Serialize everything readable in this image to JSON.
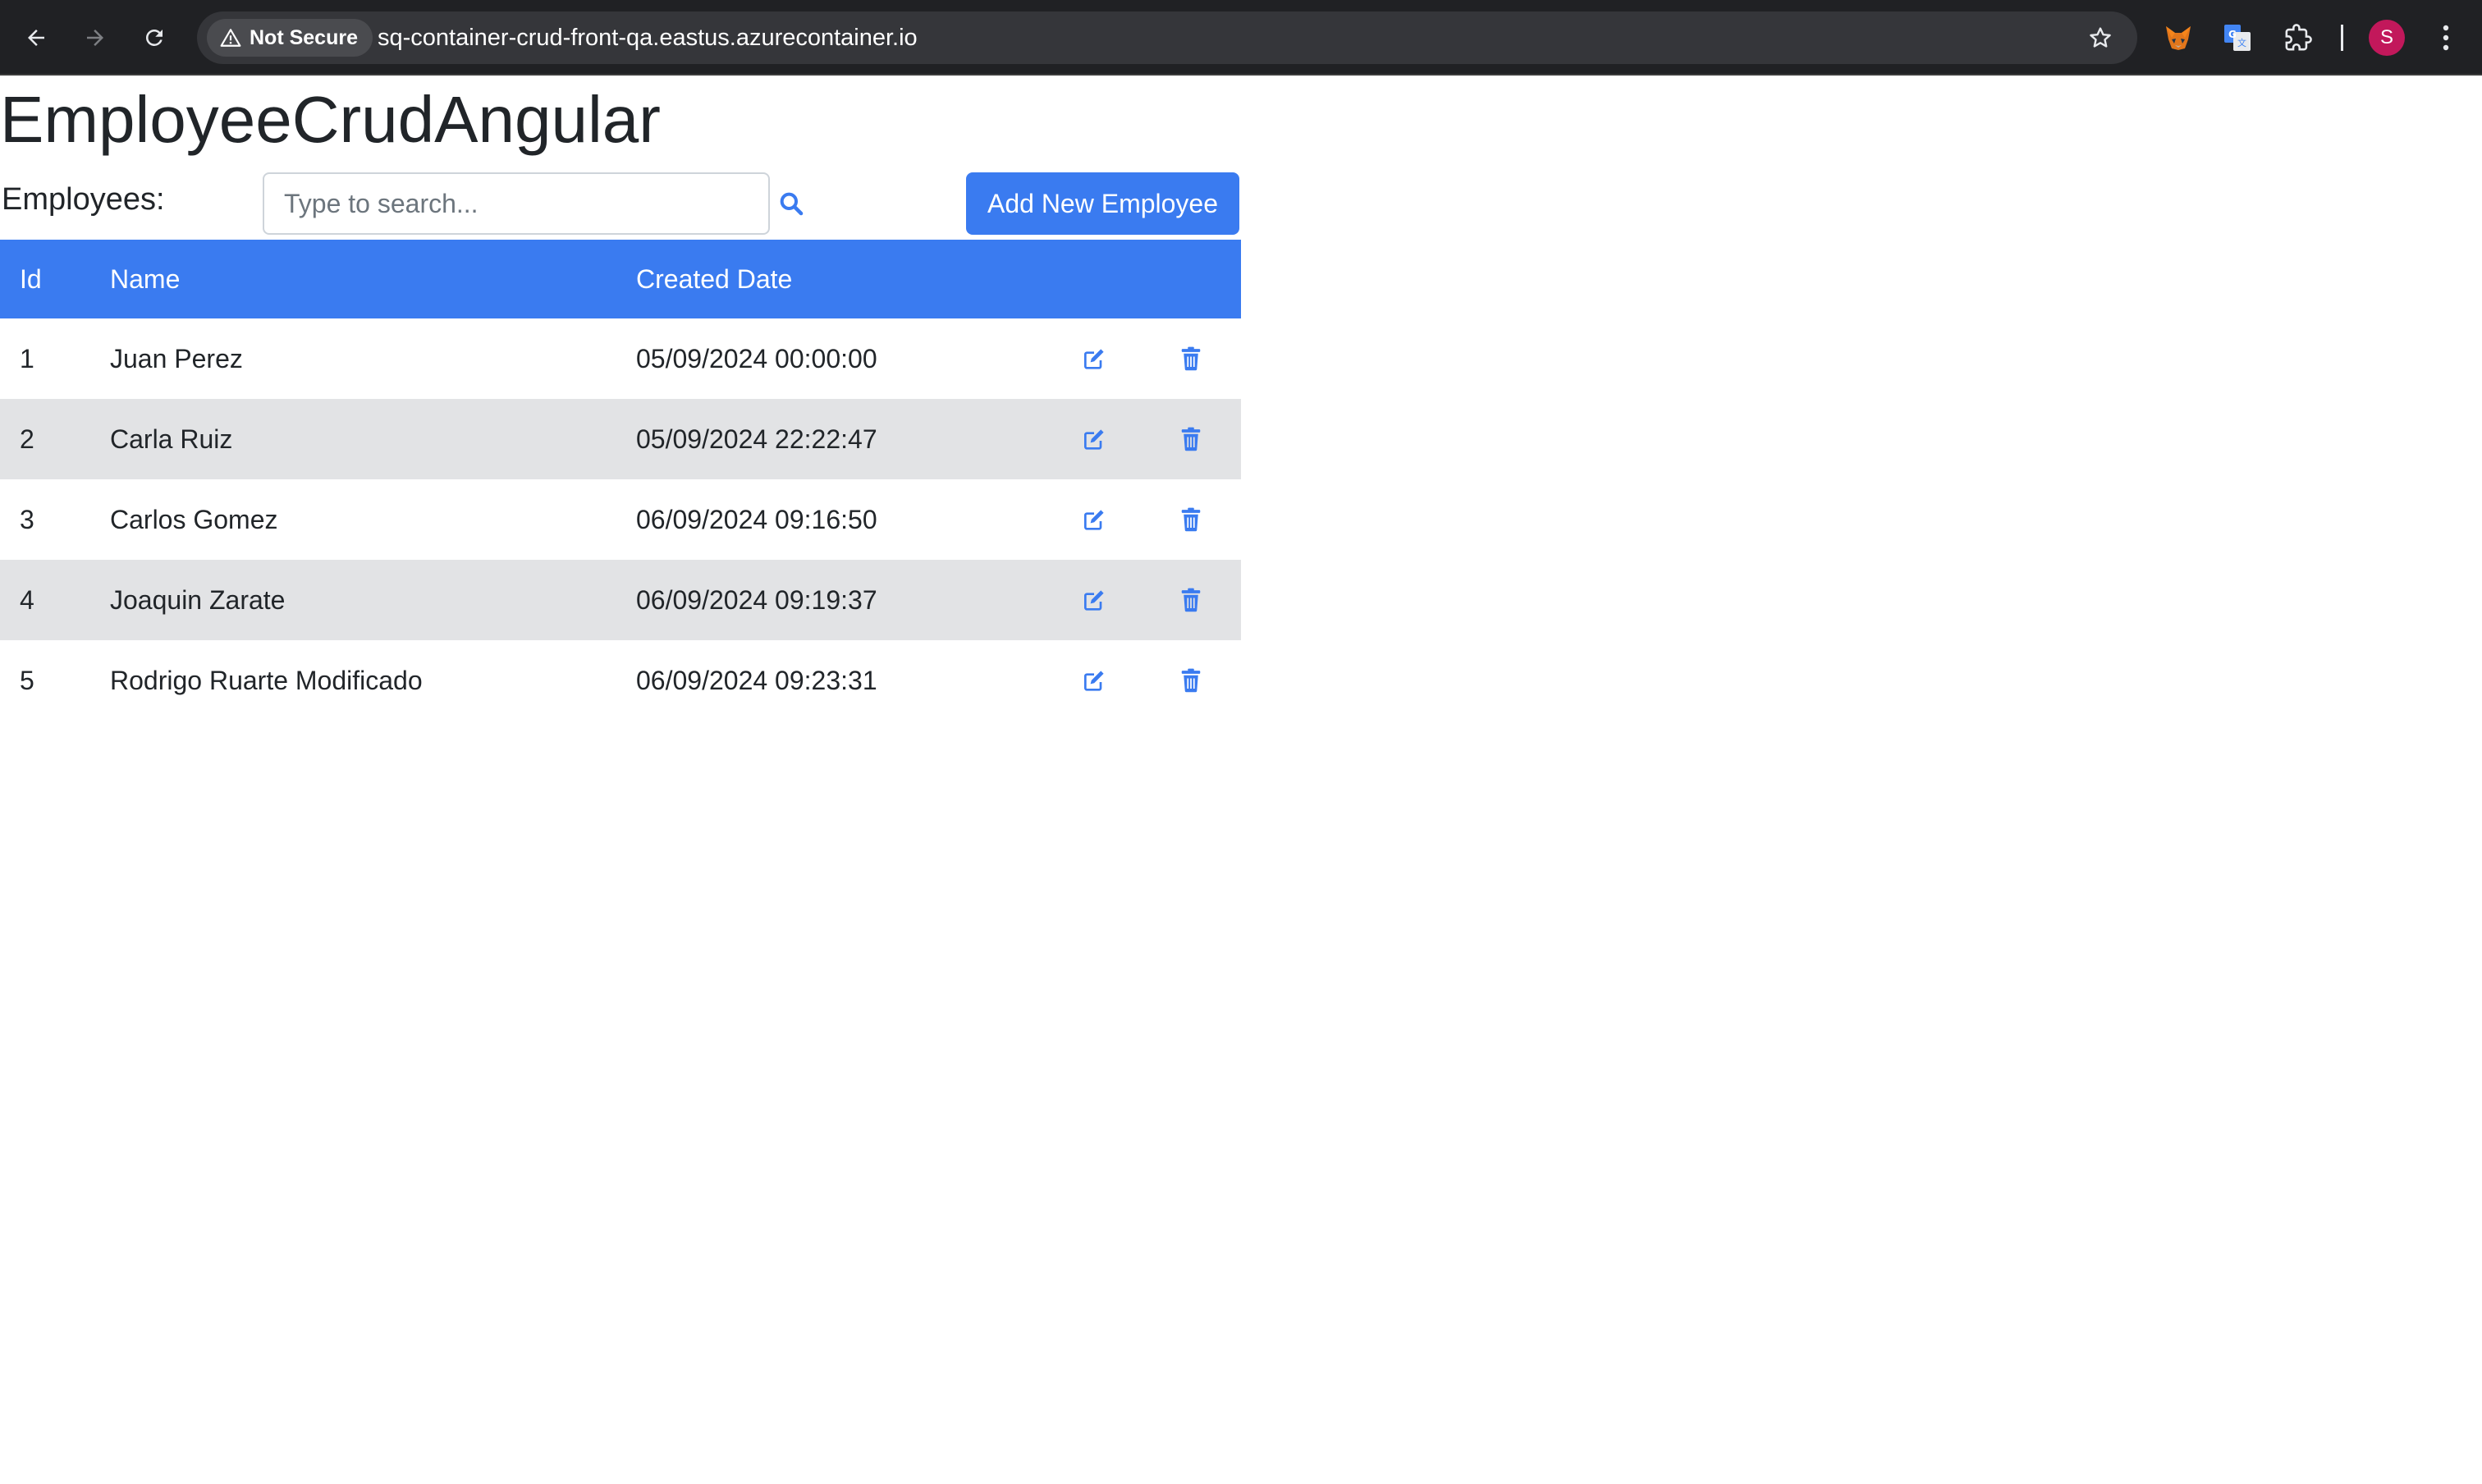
{
  "browser": {
    "security_label": "Not Secure",
    "url": "sq-container-crud-front-qa.eastus.azurecontainer.io",
    "profile_initial": "S"
  },
  "app": {
    "title": "EmployeeCrudAngular"
  },
  "toolbar": {
    "label": "Employees:",
    "search_placeholder": "Type to search...",
    "search_value": "",
    "add_button_label": "Add New Employee"
  },
  "table": {
    "headers": {
      "id": "Id",
      "name": "Name",
      "created_date": "Created Date"
    },
    "rows": [
      {
        "id": "1",
        "name": "Juan Perez",
        "created_date": "05/09/2024 00:00:00"
      },
      {
        "id": "2",
        "name": "Carla Ruiz",
        "created_date": "05/09/2024 22:22:47"
      },
      {
        "id": "3",
        "name": "Carlos Gomez",
        "created_date": "06/09/2024 09:16:50"
      },
      {
        "id": "4",
        "name": "Joaquin Zarate",
        "created_date": "06/09/2024 09:19:37"
      },
      {
        "id": "5",
        "name": "Rodrigo Ruarte Modificado",
        "created_date": "06/09/2024 09:23:31"
      }
    ]
  },
  "icons": {
    "back": "arrow-left-icon",
    "forward": "arrow-right-icon",
    "reload": "reload-icon",
    "warning": "warning-triangle-icon",
    "bookmark": "star-icon",
    "search": "search-icon",
    "edit": "edit-icon",
    "delete": "trash-icon"
  },
  "colors": {
    "primary": "#3a7bf0",
    "row_striped": "#e2e3e5",
    "chrome_bg": "#202124",
    "avatar": "#c2185b"
  }
}
